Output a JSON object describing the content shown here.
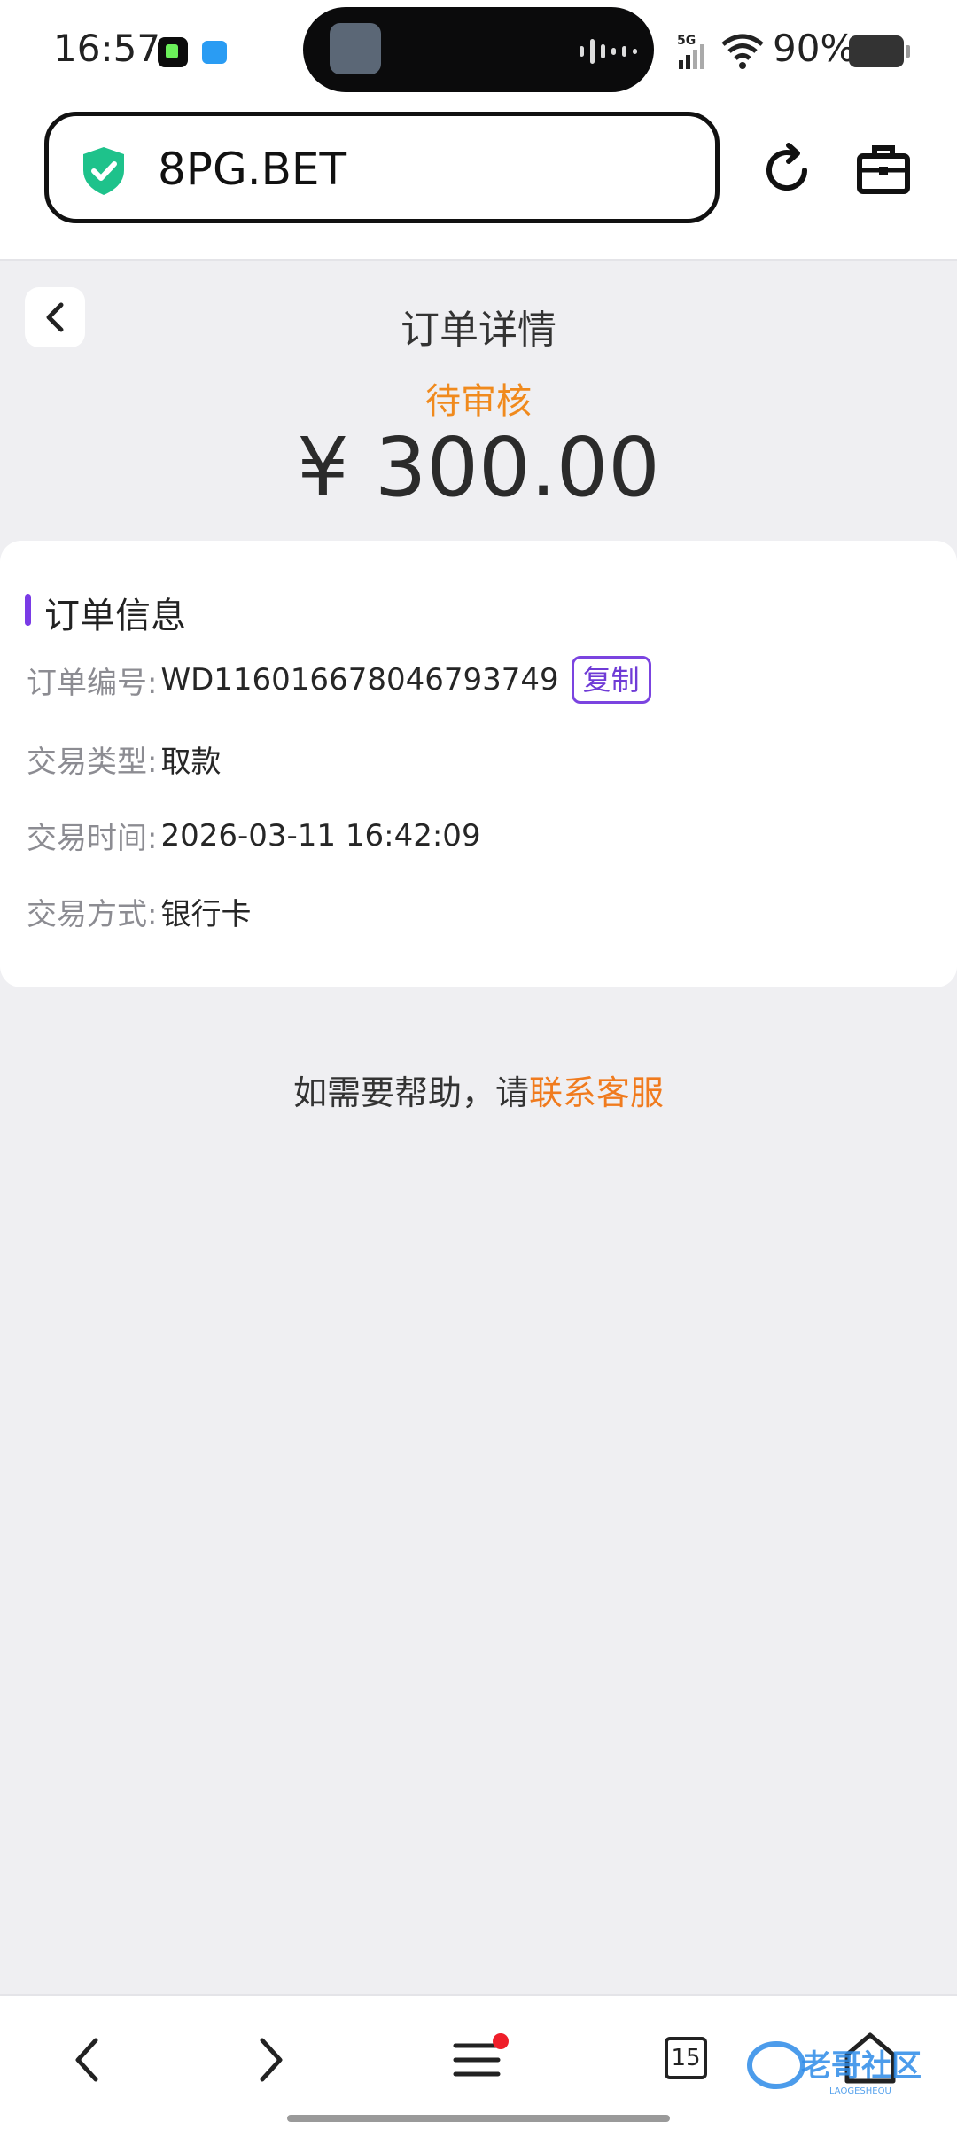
{
  "status_bar": {
    "time": "16:57",
    "network": "5G",
    "battery": "90%",
    "icons": [
      "music-app-icon",
      "cloud-app-icon",
      "signal-icon",
      "wifi-icon",
      "battery-icon"
    ]
  },
  "browser": {
    "url": "8PG.BET",
    "icons": [
      "shield-check-icon",
      "refresh-icon",
      "briefcase-icon"
    ]
  },
  "header": {
    "title": "订单详情",
    "status": "待审核",
    "amount": "¥ 300.00"
  },
  "order_info": {
    "section_title": "订单信息",
    "rows": [
      {
        "label": "订单编号:",
        "value": "WD116016678046793749"
      },
      {
        "label": "交易类型:",
        "value": "取款"
      },
      {
        "label": "交易时间:",
        "value": "2026-03-11 16:42:09"
      },
      {
        "label": "交易方式:",
        "value": "银行卡"
      }
    ],
    "copy_label": "复制"
  },
  "help": {
    "text": "如需要帮助，请",
    "link": "联系客服"
  },
  "bottom_nav": {
    "tab_count": "15",
    "watermark": "老哥社区",
    "watermark_sub": "LAOGESHEQU"
  },
  "colors": {
    "accent": "#7a3be6",
    "status_orange": "#f08a1d",
    "link_orange": "#f07b1e",
    "shield_green": "#1ec28b"
  }
}
